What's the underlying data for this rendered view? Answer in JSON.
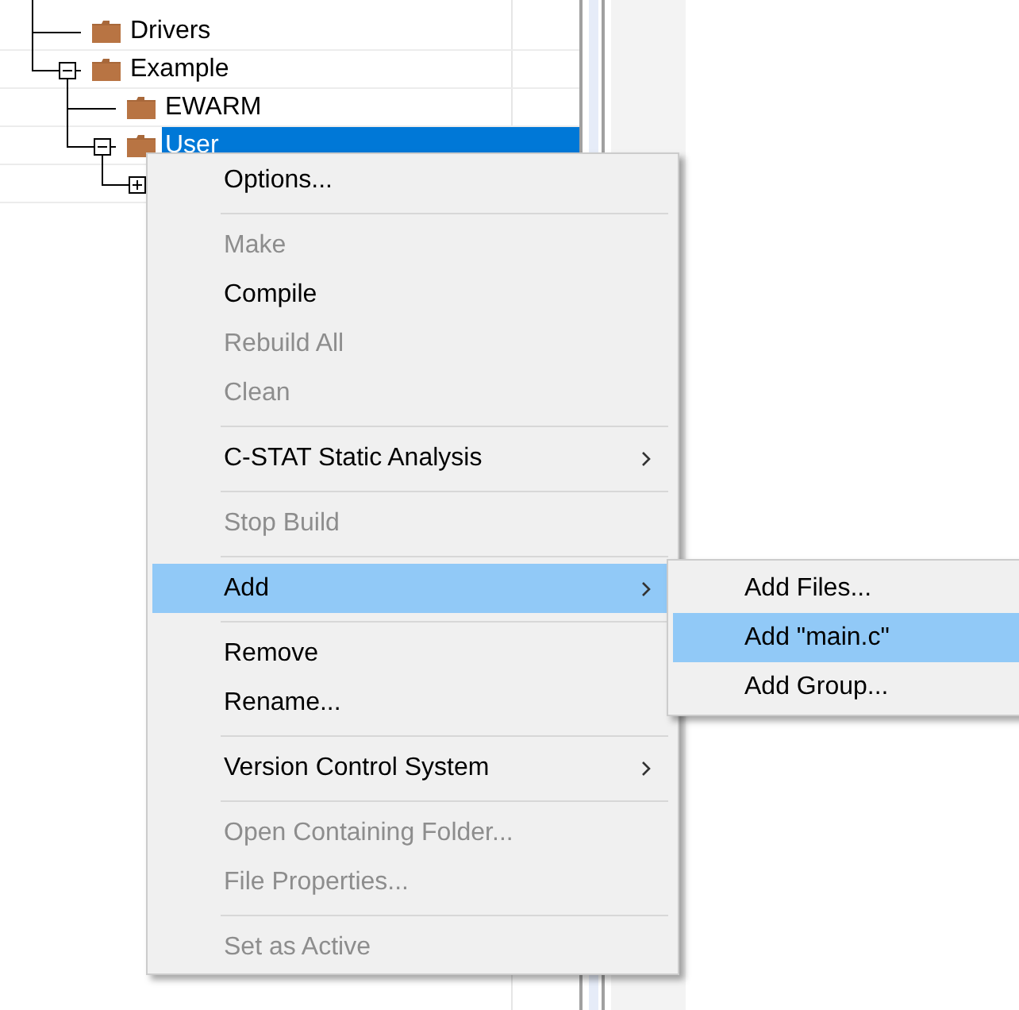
{
  "tree": {
    "nodes": [
      {
        "label": "Drivers",
        "selected": false
      },
      {
        "label": "Example",
        "expanded": true,
        "selected": false,
        "children": [
          {
            "label": "EWARM",
            "selected": false
          },
          {
            "label": "User",
            "expanded": true,
            "selected": true,
            "children": [
              {
                "expanded": false
              }
            ]
          }
        ]
      }
    ]
  },
  "context_menu": {
    "items": [
      {
        "kind": "item",
        "label": "Options...",
        "disabled": false,
        "selected": false,
        "submenu": false
      },
      {
        "kind": "separator"
      },
      {
        "kind": "item",
        "label": "Make",
        "disabled": true,
        "selected": false,
        "submenu": false
      },
      {
        "kind": "item",
        "label": "Compile",
        "disabled": false,
        "selected": false,
        "submenu": false
      },
      {
        "kind": "item",
        "label": "Rebuild All",
        "disabled": true,
        "selected": false,
        "submenu": false
      },
      {
        "kind": "item",
        "label": "Clean",
        "disabled": true,
        "selected": false,
        "submenu": false
      },
      {
        "kind": "separator"
      },
      {
        "kind": "item",
        "label": "C-STAT Static Analysis",
        "disabled": false,
        "selected": false,
        "submenu": true
      },
      {
        "kind": "separator"
      },
      {
        "kind": "item",
        "label": "Stop Build",
        "disabled": true,
        "selected": false,
        "submenu": false
      },
      {
        "kind": "separator"
      },
      {
        "kind": "item",
        "label": "Add",
        "disabled": false,
        "selected": true,
        "submenu": true
      },
      {
        "kind": "separator"
      },
      {
        "kind": "item",
        "label": "Remove",
        "disabled": false,
        "selected": false,
        "submenu": false
      },
      {
        "kind": "item",
        "label": "Rename...",
        "disabled": false,
        "selected": false,
        "submenu": false
      },
      {
        "kind": "separator"
      },
      {
        "kind": "item",
        "label": "Version Control System",
        "disabled": false,
        "selected": false,
        "submenu": true
      },
      {
        "kind": "separator"
      },
      {
        "kind": "item",
        "label": "Open Containing Folder...",
        "disabled": true,
        "selected": false,
        "submenu": false
      },
      {
        "kind": "item",
        "label": "File Properties...",
        "disabled": true,
        "selected": false,
        "submenu": false
      },
      {
        "kind": "separator"
      },
      {
        "kind": "item",
        "label": "Set as Active",
        "disabled": true,
        "selected": false,
        "submenu": false
      }
    ]
  },
  "submenu": {
    "items": [
      {
        "label": "Add Files...",
        "selected": false
      },
      {
        "label": "Add \"main.c\"",
        "selected": true
      },
      {
        "label": "Add Group...",
        "selected": false
      }
    ]
  }
}
